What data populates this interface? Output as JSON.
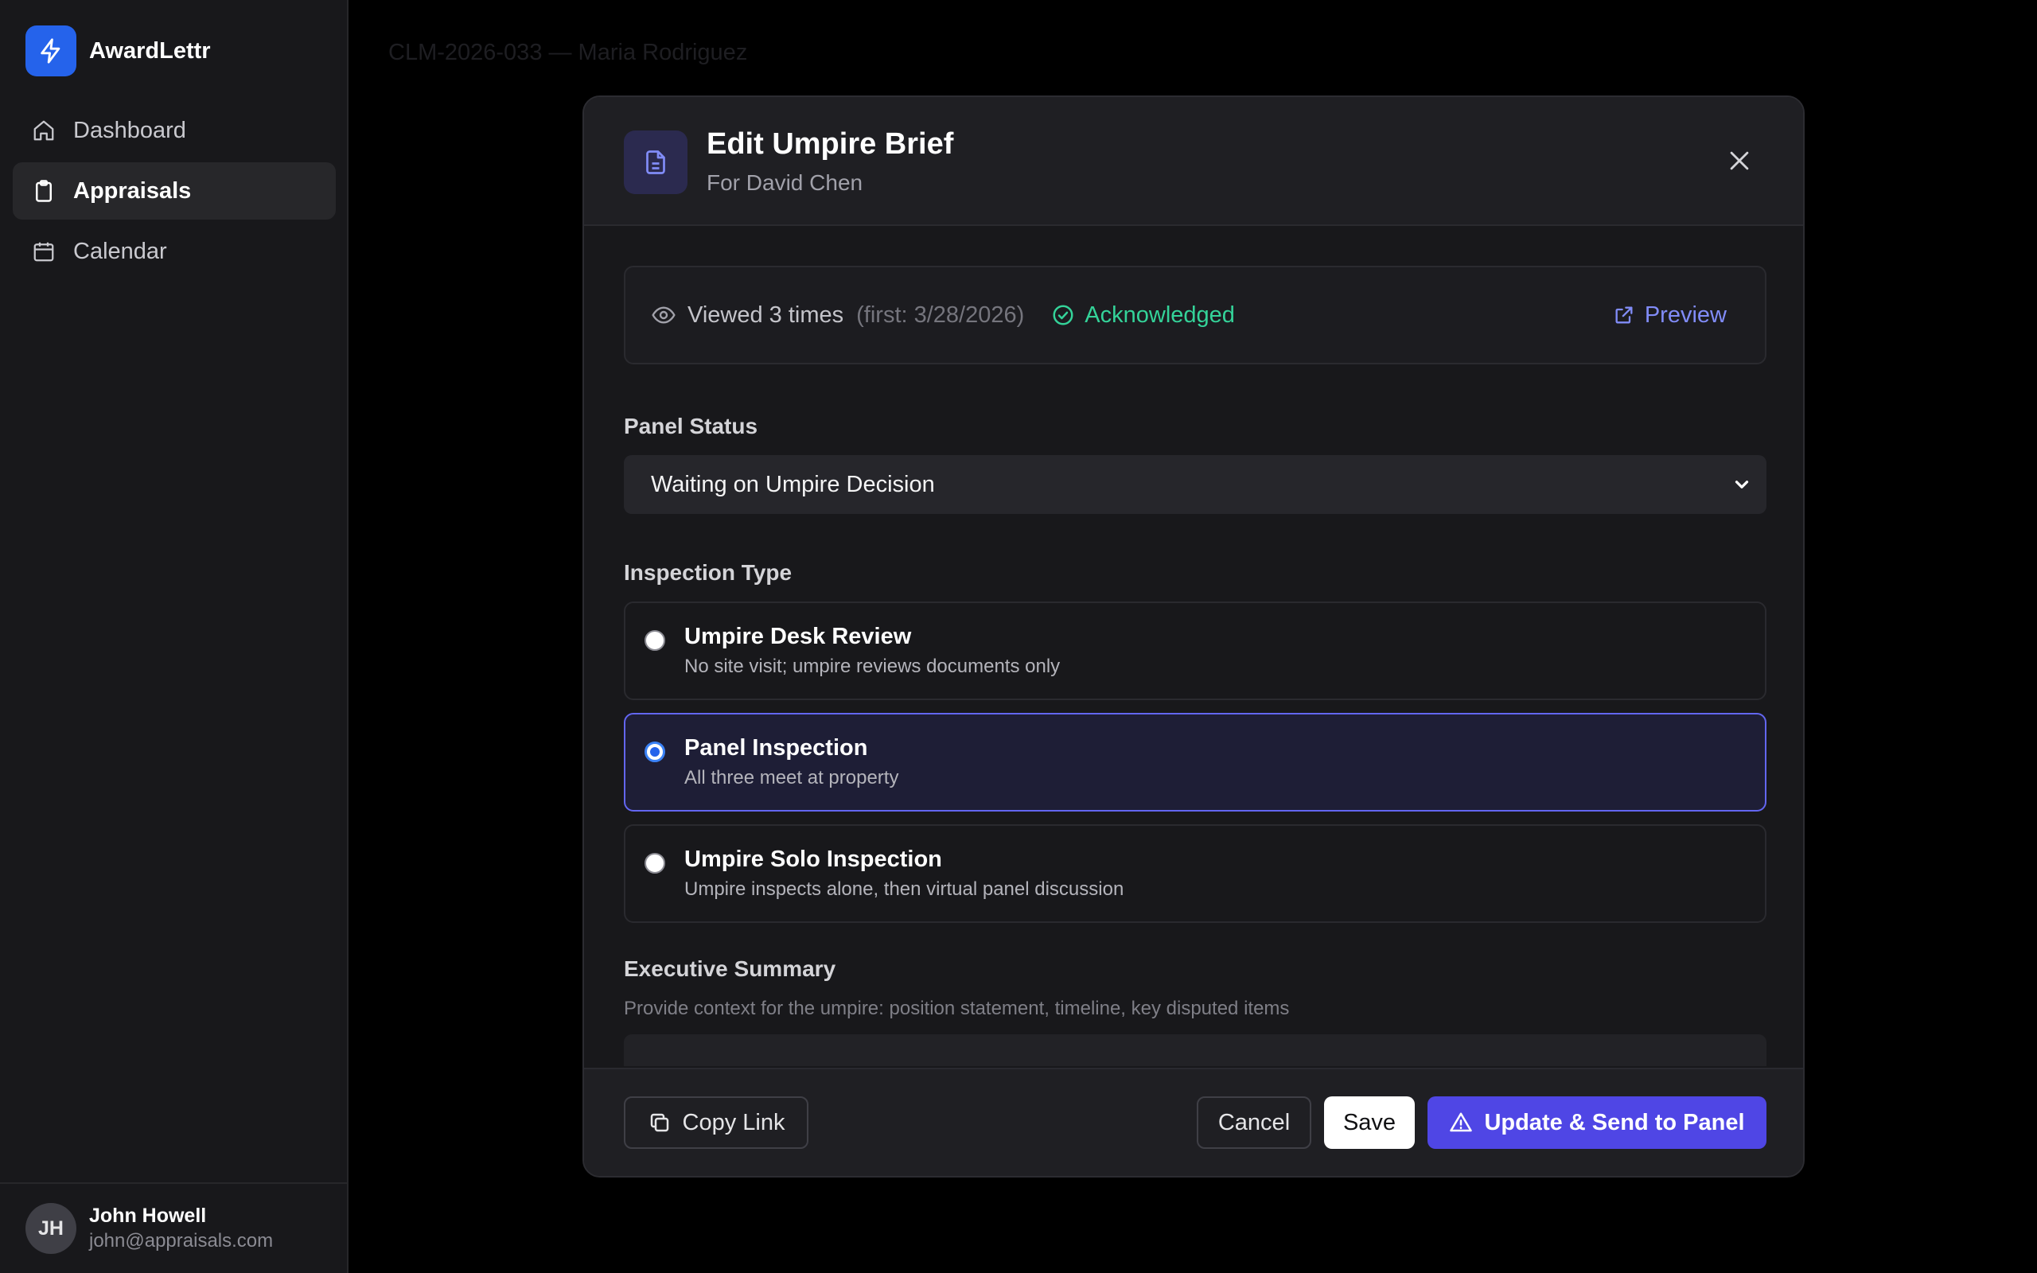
{
  "app": {
    "name": "AwardLettr"
  },
  "sidebar": {
    "items": [
      {
        "label": "Dashboard",
        "icon": "home-icon",
        "active": false
      },
      {
        "label": "Appraisals",
        "icon": "clipboard-icon",
        "active": true
      },
      {
        "label": "Calendar",
        "icon": "calendar-icon",
        "active": false
      }
    ]
  },
  "user": {
    "initials": "JH",
    "name": "John Howell",
    "email": "john@appraisals.com"
  },
  "page": {
    "title": "CLM-2026-033 — Maria Rodriguez"
  },
  "modal": {
    "title": "Edit Umpire Brief",
    "subtitle": "For David Chen",
    "views": {
      "viewed_text": "Viewed 3 times",
      "first_text": "(first: 3/28/2026)",
      "status_text": "Acknowledged",
      "preview_label": "Preview"
    },
    "panel_status": {
      "label": "Panel Status",
      "value": "Waiting on Umpire Decision"
    },
    "inspection": {
      "label": "Inspection Type",
      "options": [
        {
          "title": "Umpire Desk Review",
          "desc": "No site visit; umpire reviews documents only",
          "selected": false
        },
        {
          "title": "Panel Inspection",
          "desc": "All three meet at property",
          "selected": true
        },
        {
          "title": "Umpire Solo Inspection",
          "desc": "Umpire inspects alone, then virtual panel discussion",
          "selected": false
        }
      ]
    },
    "executive_summary": {
      "label": "Executive Summary",
      "helper": "Provide context for the umpire: position statement, timeline, key disputed items"
    },
    "footer": {
      "copy_label": "Copy Link",
      "cancel_label": "Cancel",
      "save_label": "Save",
      "send_label": "Update & Send to Panel"
    }
  },
  "colors": {
    "accent": "#4f46e5",
    "brand": "#2563eb",
    "success": "#34d399",
    "link": "#818cf8"
  }
}
